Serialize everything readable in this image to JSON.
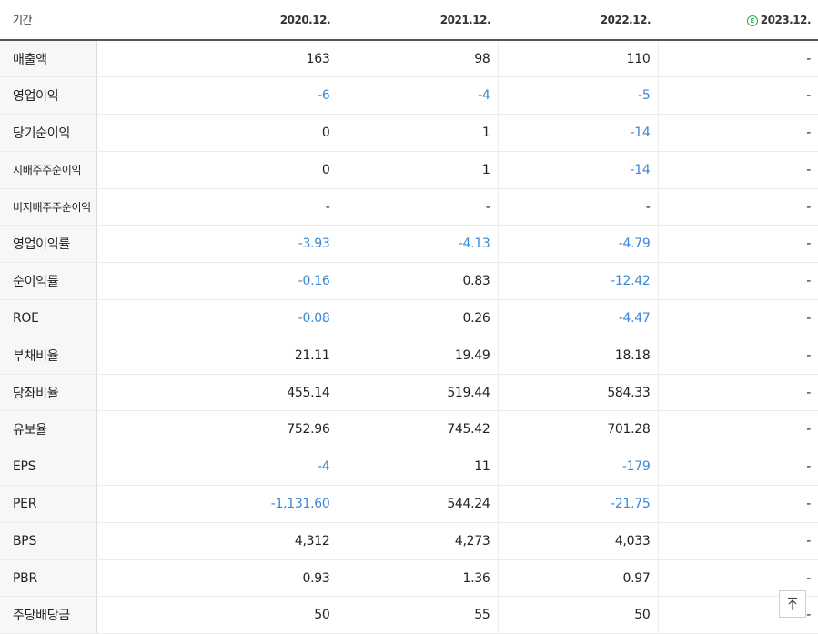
{
  "header": {
    "label": "기간",
    "periods": [
      "2020.12.",
      "2021.12.",
      "2022.12.",
      "2023.12."
    ],
    "estimate_icon": "E"
  },
  "icons": {
    "estimate": "estimate-circle-icon",
    "scroll_top": "arrow-up-to-top-icon"
  },
  "colors": {
    "negative": "#3b87d9",
    "estimate": "#2eaa4a"
  },
  "rows": [
    {
      "label": "매출액",
      "values": [
        "163",
        "98",
        "110",
        "-"
      ]
    },
    {
      "label": "영업이익",
      "values": [
        "-6",
        "-4",
        "-5",
        "-"
      ]
    },
    {
      "label": "당기순이익",
      "values": [
        "0",
        "1",
        "-14",
        "-"
      ]
    },
    {
      "label": "지배주주순이익",
      "values": [
        "0",
        "1",
        "-14",
        "-"
      ]
    },
    {
      "label": "비지배주주순이익",
      "values": [
        "-",
        "-",
        "-",
        "-"
      ]
    },
    {
      "label": "영업이익률",
      "values": [
        "-3.93",
        "-4.13",
        "-4.79",
        "-"
      ]
    },
    {
      "label": "순이익률",
      "values": [
        "-0.16",
        "0.83",
        "-12.42",
        "-"
      ]
    },
    {
      "label": "ROE",
      "values": [
        "-0.08",
        "0.26",
        "-4.47",
        "-"
      ]
    },
    {
      "label": "부채비율",
      "values": [
        "21.11",
        "19.49",
        "18.18",
        "-"
      ]
    },
    {
      "label": "당좌비율",
      "values": [
        "455.14",
        "519.44",
        "584.33",
        "-"
      ]
    },
    {
      "label": "유보율",
      "values": [
        "752.96",
        "745.42",
        "701.28",
        "-"
      ]
    },
    {
      "label": "EPS",
      "values": [
        "-4",
        "11",
        "-179",
        "-"
      ]
    },
    {
      "label": "PER",
      "values": [
        "-1,131.60",
        "544.24",
        "-21.75",
        "-"
      ]
    },
    {
      "label": "BPS",
      "values": [
        "4,312",
        "4,273",
        "4,033",
        "-"
      ]
    },
    {
      "label": "PBR",
      "values": [
        "0.93",
        "1.36",
        "0.97",
        "-"
      ]
    },
    {
      "label": "주당배당금",
      "values": [
        "50",
        "55",
        "50",
        "-"
      ]
    }
  ]
}
